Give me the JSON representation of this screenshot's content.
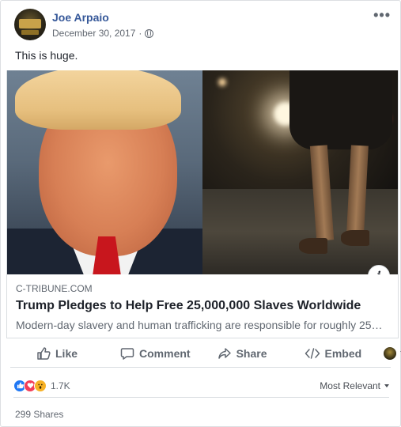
{
  "post": {
    "author": "Joe Arpaio",
    "date": "December 30, 2017",
    "separator": "·",
    "privacy_icon": "globe-icon",
    "more_icon": "more-options-icon",
    "text": "This is huge."
  },
  "link": {
    "domain": "C-TRIBUNE.COM",
    "title": "Trump Pledges to Help Free 25,000,000 Slaves Worldwide",
    "description": "Modern-day slavery and human trafficking are responsible for roughly 25…",
    "info_label": "i"
  },
  "actions": {
    "like": "Like",
    "comment": "Comment",
    "share": "Share",
    "embed": "Embed"
  },
  "reactions": {
    "types": [
      "like",
      "love",
      "wow"
    ],
    "count": "1.7K",
    "sort_label": "Most Relevant"
  },
  "shares": "299 Shares",
  "colors": {
    "author_link": "#365899",
    "like_blue": "#2078f4",
    "love_red": "#f33e58",
    "wow_yellow": "#f7b125",
    "secondary_text": "#606770"
  }
}
